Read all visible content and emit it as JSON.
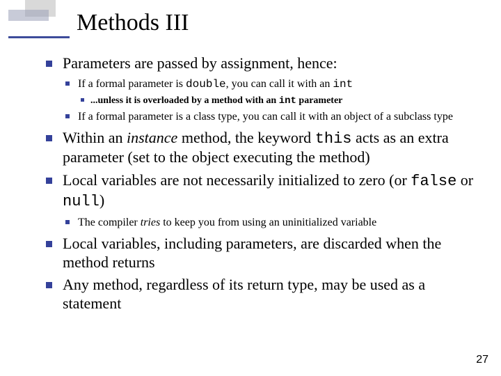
{
  "title": "Methods III",
  "page_number": "27",
  "bullets": {
    "b1": {
      "text": "Parameters are passed by assignment, hence:",
      "sub": {
        "s1": {
          "prefix": "If a formal parameter is ",
          "code1": "double",
          "mid": ", you can call it with an ",
          "code2": "int",
          "sub": {
            "t1": {
              "prefix": "...unless it is overloaded by a method with an ",
              "code": "int",
              "suffix": " parameter"
            }
          }
        },
        "s2": "If a formal parameter is a class type, you can call it with an object of a subclass type"
      }
    },
    "b2": {
      "prefix": "Within an ",
      "em": "instance",
      "mid1": " method, the keyword ",
      "code": "this",
      "suffix": " acts as an extra parameter (set to the object executing the method)"
    },
    "b3": {
      "prefix": "Local variables are not necessarily initialized to zero (or ",
      "code1": "false",
      "mid": " or ",
      "code2": "null",
      "suffix": ")",
      "sub": {
        "s1": {
          "prefix": "The compiler ",
          "em": "tries",
          "suffix": " to keep you from using an uninitialized variable"
        }
      }
    },
    "b4": "Local variables, including parameters, are discarded when the method returns",
    "b5": "Any method, regardless of its return type, may be used as a statement"
  }
}
